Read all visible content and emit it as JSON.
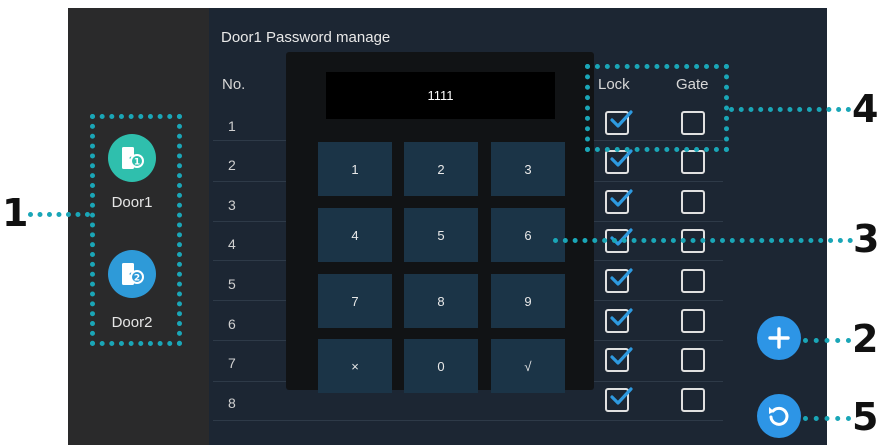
{
  "header": {
    "title": "Door1 Password manage"
  },
  "table": {
    "col_no": "No.",
    "col_lock": "Lock",
    "col_gate": "Gate",
    "rows": [
      {
        "no": "1",
        "lock": true,
        "gate": false
      },
      {
        "no": "2",
        "lock": true,
        "gate": false
      },
      {
        "no": "3",
        "lock": true,
        "gate": false
      },
      {
        "no": "4",
        "lock": true,
        "gate": false
      },
      {
        "no": "5",
        "lock": true,
        "gate": false
      },
      {
        "no": "6",
        "lock": true,
        "gate": false
      },
      {
        "no": "7",
        "lock": true,
        "gate": false
      },
      {
        "no": "8",
        "lock": true,
        "gate": false
      }
    ]
  },
  "sidebar": {
    "door1_label": "Door1",
    "door2_label": "Door2"
  },
  "keypad": {
    "display_value": "1111",
    "keys": [
      "1",
      "2",
      "3",
      "4",
      "5",
      "6",
      "7",
      "8",
      "9",
      "×",
      "0",
      "√"
    ]
  },
  "callouts": [
    "1",
    "2",
    "3",
    "4",
    "5"
  ],
  "colors": {
    "accent": "#1aa6b7",
    "door1": "#2fbfad",
    "door2": "#2e9ad8",
    "check": "#2e9ae0",
    "action_button": "#2d95e6"
  },
  "icons": {
    "door1": "door-1-icon",
    "door2": "door-2-icon",
    "add": "plus-icon",
    "refresh": "refresh-icon"
  }
}
